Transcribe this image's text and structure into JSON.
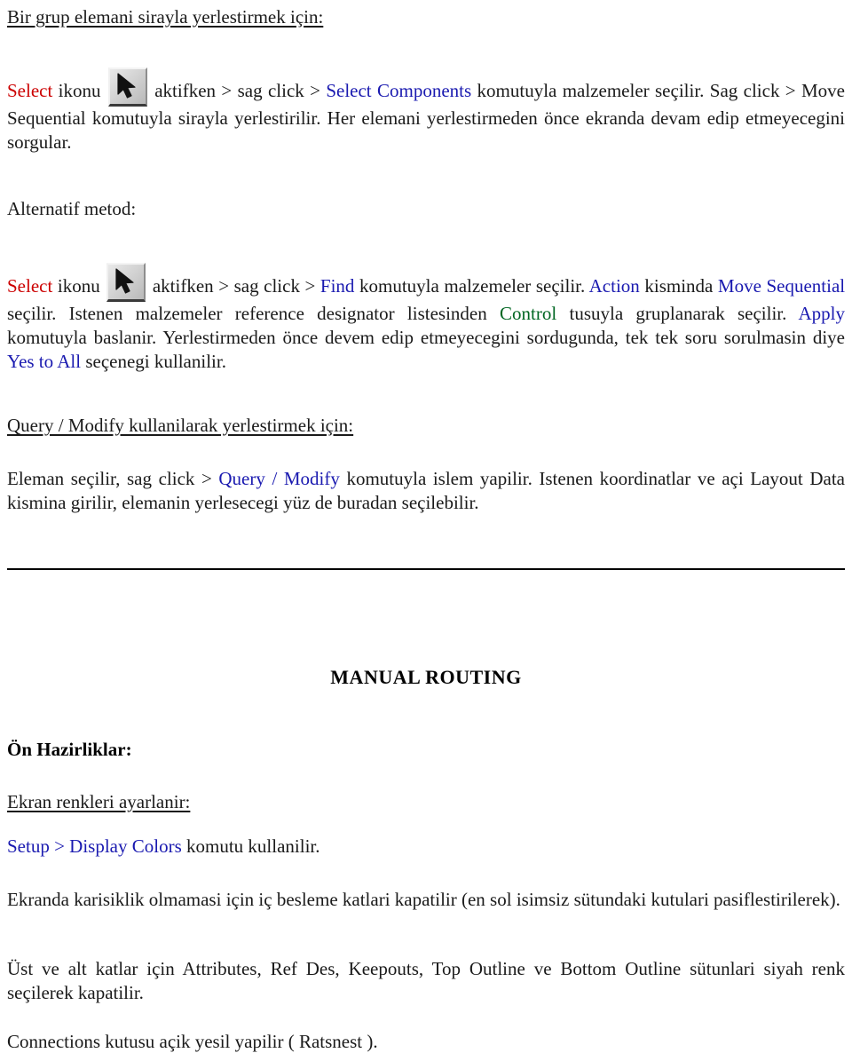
{
  "document": {
    "language": "tr",
    "colors": {
      "red": "#cc0000",
      "blue": "#1a1ab0",
      "green": "#006622",
      "text": "#1a1a1a"
    },
    "section_group_place": {
      "heading": "Bir grup elemani sirayla yerlestirmek için:",
      "icon_name": "select-tool-icon",
      "line1_a": "Select",
      "line1_b": "ikonu",
      "line1_c": "aktifken > sag click >",
      "line1_d": "Select Components",
      "line1_e": "komutuyla malzemeler seçilir. Sag click > Move Sequential komutuyla sirayla yerlestirilir. Her elemani yerlestirmeden önce ekranda devam edip etmeyecegini sorgular."
    },
    "section_alternative": {
      "heading": "Alternatif metod:",
      "icon_name": "select-tool-icon",
      "t1": "Select",
      "t2": "ikonu",
      "t3": "aktifken > sag click >",
      "t4": "Find",
      "t5": "komutuyla malzemeler seçilir.",
      "t6": "Action",
      "t7": "kisminda",
      "t8": "Move Sequential",
      "t9": "seçilir. Istenen malzemeler reference designator listesinden",
      "t10": "Control",
      "t11": "tusuyla gruplanarak seçilir.",
      "t12": "Apply",
      "t13": "komutuyla baslanir. Yerlestirmeden önce devem edip etmeyecegini sordugunda, tek tek soru sorulmasin diye",
      "t14": "Yes to All",
      "t15": "seçenegi kullanilir."
    },
    "section_query_modify": {
      "heading": "Query / Modify kullanilarak yerlestirmek için:",
      "p1": "Eleman seçilir, sag click >",
      "p2": "Query / Modify",
      "p3": "komutuyla islem yapilir. Istenen koordinatlar ve açi Layout Data kismina girilir, elemanin yerlesecegi yüz de buradan seçilebilir."
    },
    "section_manual_routing": {
      "title": "MANUAL ROUTING",
      "subheading": "Ön Hazirliklar:",
      "screen_colors_heading": "Ekran renkleri ayarlanir:",
      "setup_command": "Setup > Display Colors",
      "setup_rest": "komutu kullanilir.",
      "p_inner_layers": "Ekranda karisiklik olmamasi için iç besleme katlari kapatilir (en sol isimsiz sütundaki kutulari pasiflestirilerek).",
      "p_layers": "Üst ve alt katlar için Attributes, Ref Des, Keepouts, Top Outline ve Bottom Outline sütunlari siyah renk seçilerek kapatilir.",
      "p_connections": "Connections kutusu açik yesil yapilir ( Ratsnest )."
    }
  }
}
